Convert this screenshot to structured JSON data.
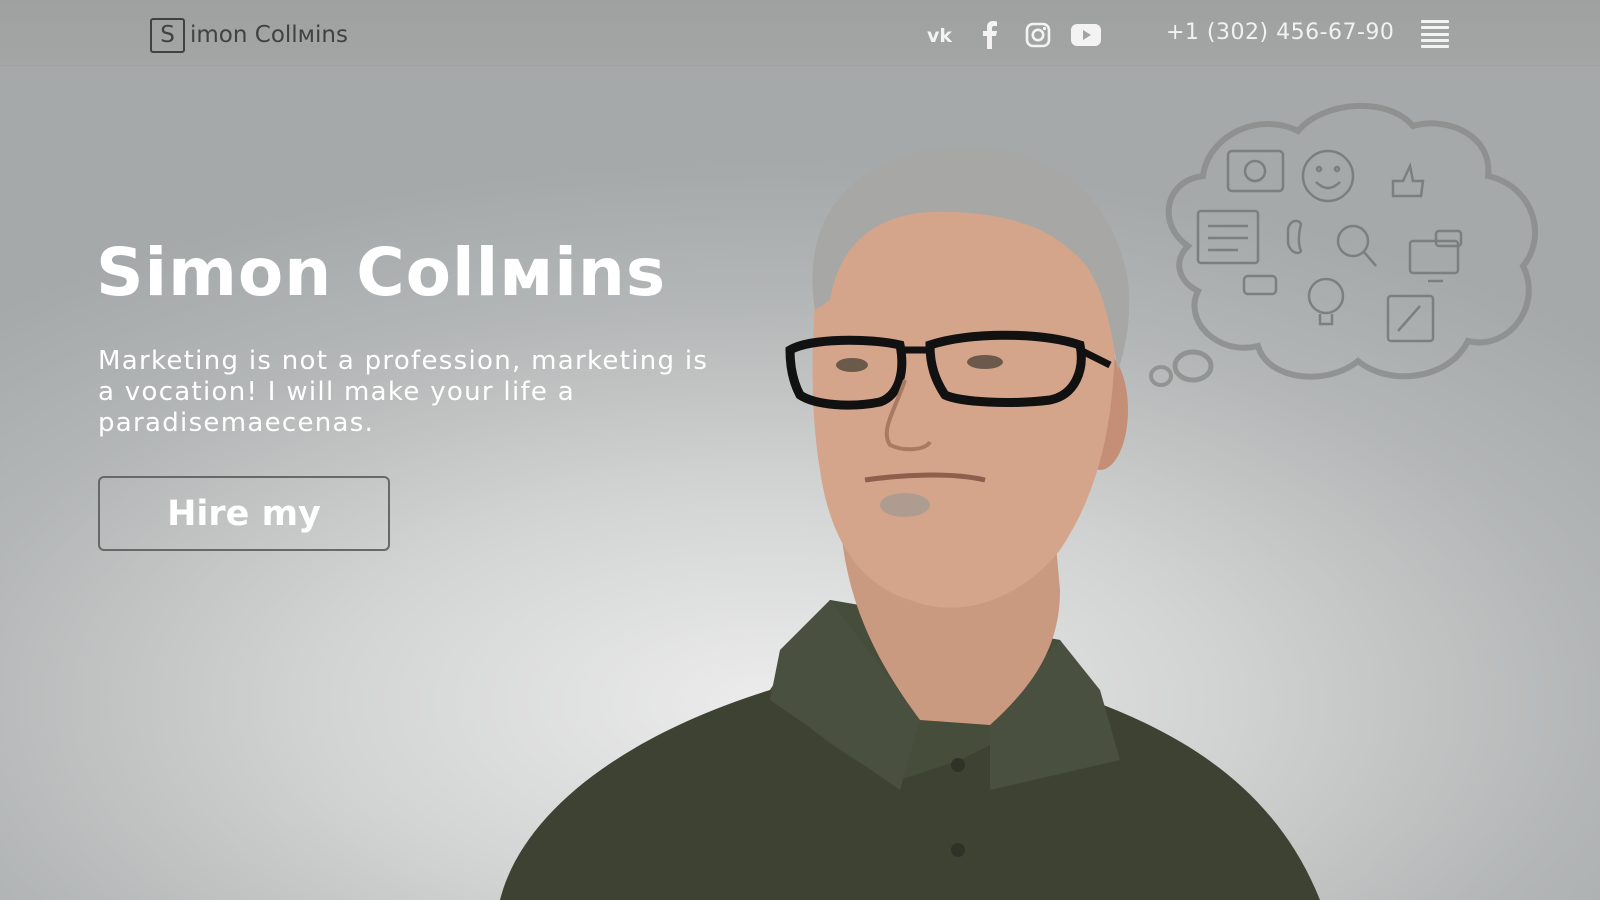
{
  "header": {
    "logo_letter": "S",
    "logo_rest": "imon Collмins",
    "socials": [
      "vk-icon",
      "facebook-icon",
      "instagram-icon",
      "youtube-icon"
    ],
    "phone": "+1 (302) 456-67-90",
    "menu_icon": "hamburger-icon"
  },
  "hero": {
    "title": "Simon Collмins",
    "text": "Marketing is not a profession, marketing is a vocation! I will make your life a paradisemaecenas.",
    "button_label": "Hire my"
  },
  "decor": {
    "thought_icons": [
      "camera-icon",
      "smiley-icon",
      "thumbs-up-icon",
      "document-icon",
      "phone-icon",
      "search-icon",
      "monitor-chat-icon",
      "cd-icon",
      "lightbulb-icon",
      "pen-note-icon"
    ]
  }
}
